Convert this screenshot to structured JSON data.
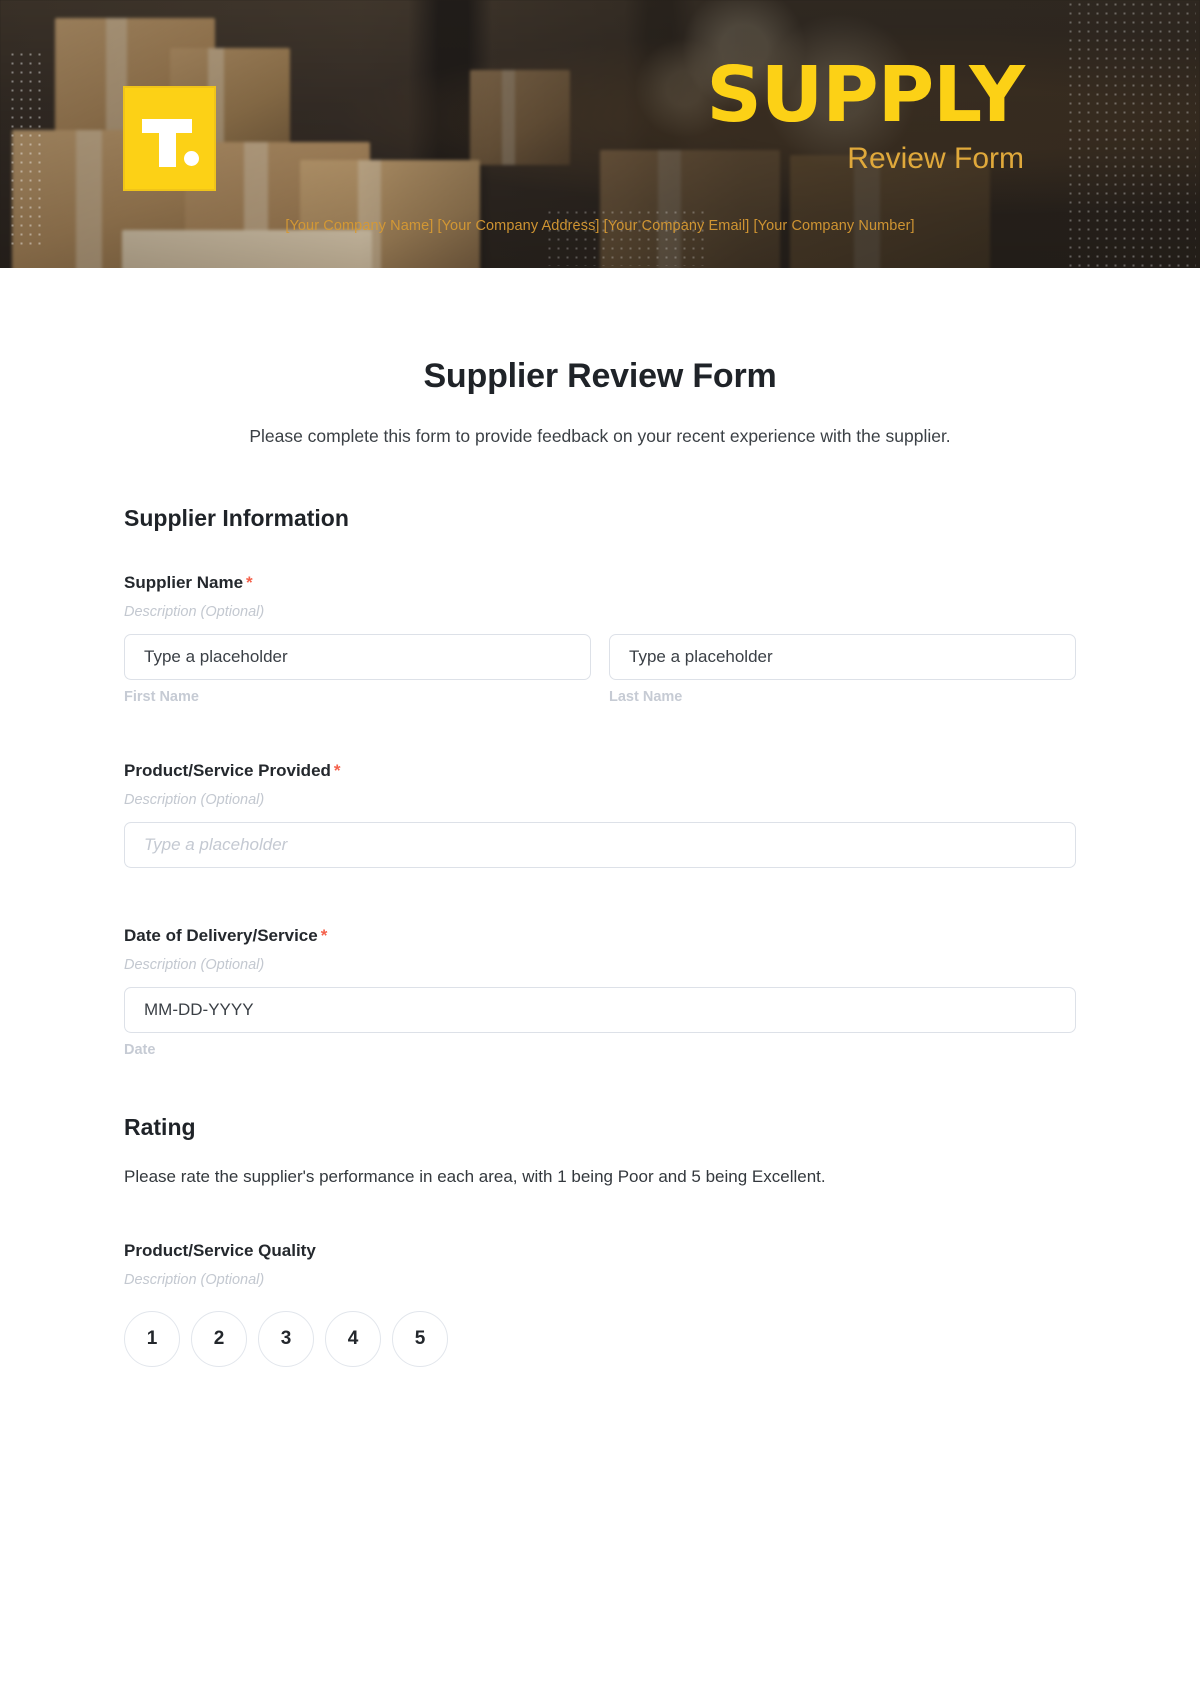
{
  "banner": {
    "logo_letter": "T",
    "brand_title": "SUPPLY",
    "brand_subtitle": "Review Form",
    "company_line": "[Your Company Name] [Your Company Address] [Your Company Email] [Your Company Number]",
    "accent_color": "#fcd116",
    "subtitle_color": "#e0a93b"
  },
  "form": {
    "title": "Supplier Review Form",
    "intro": "Please complete this form to provide feedback on your recent experience with the supplier.",
    "required_marker": "*",
    "description_placeholder": "Description (Optional)"
  },
  "supplier_information": {
    "heading": "Supplier Information",
    "fields": [
      {
        "label": "Supplier Name",
        "required": true,
        "description": "Description (Optional)",
        "inputs": [
          {
            "placeholder": "Type a placeholder",
            "sub_label": "First Name"
          },
          {
            "placeholder": "Type a placeholder",
            "sub_label": "Last Name"
          }
        ]
      },
      {
        "label": "Product/Service Provided",
        "required": true,
        "description": "Description (Optional)",
        "inputs": [
          {
            "placeholder": "Type a placeholder",
            "sub_label": ""
          }
        ]
      },
      {
        "label": "Date of Delivery/Service",
        "required": true,
        "description": "Description (Optional)",
        "inputs": [
          {
            "placeholder": "MM-DD-YYYY",
            "sub_label": "Date"
          }
        ]
      }
    ]
  },
  "rating": {
    "heading": "Rating",
    "description": "Please rate the supplier's performance in each area, with 1 being Poor and 5 being Excellent.",
    "items": [
      {
        "label": "Product/Service Quality",
        "description": "Description (Optional)",
        "options": [
          "1",
          "2",
          "3",
          "4",
          "5"
        ]
      }
    ]
  },
  "colors": {
    "required_red": "#f4604a",
    "label_dark": "#24282d",
    "muted_gray": "#c3c8d0",
    "border": "#dde1e8"
  }
}
